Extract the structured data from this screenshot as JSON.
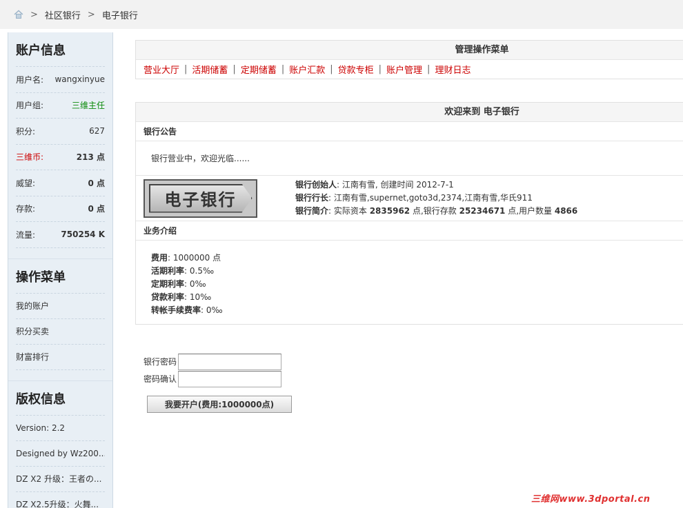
{
  "breadcrumb": {
    "sep": ">",
    "items": [
      "社区银行",
      "电子银行"
    ]
  },
  "sidebar": {
    "account_title": "账户信息",
    "account_rows": [
      {
        "k": "用户名:",
        "v": "wangxinyue"
      },
      {
        "k": "用户组:",
        "v": "三维主任"
      },
      {
        "k": "积分:",
        "v": "627"
      },
      {
        "k": "三维币:",
        "v": "213 点"
      },
      {
        "k": "威望:",
        "v": "0 点"
      },
      {
        "k": "存款:",
        "v": "0 点"
      },
      {
        "k": "流量:",
        "v": "750254 K"
      }
    ],
    "menu_title": "操作菜单",
    "menu_items": [
      "我的账户",
      "积分买卖",
      "财富排行"
    ],
    "copy_title": "版权信息",
    "copy_items": [
      "Version: 2.2",
      "Designed by Wz200...",
      "DZ X2 升级：王者の...",
      "DZ X2.5升级：火舞..."
    ]
  },
  "manage": {
    "title": "管理操作菜单",
    "bar": "|",
    "links": [
      "营业大厅",
      "活期储蓄",
      "定期储蓄",
      "账户汇款",
      "贷款专柜",
      "账户管理",
      "理财日志"
    ]
  },
  "welcome": {
    "title": "欢迎来到 电子银行",
    "notice_label": "银行公告",
    "notice_text": "银行营业中，欢迎光临......",
    "logo_text": "电子银行",
    "founder_label": "银行创始人",
    "founder_text": ": 江南有雪, 创建时间 2012-7-1",
    "heads_label": "银行行长",
    "heads_text": ": 江南有雪,supernet,goto3d,2374,江南有雪,华氏911",
    "intro_label": "银行简介",
    "intro_p1": ": 实际资本 ",
    "capital": "2835962",
    "intro_p2": " 点,银行存款 ",
    "deposits": "25234671",
    "intro_p3": " 点,用户数量 ",
    "users": "4866",
    "biz_label": "业务介绍",
    "biz_rows": [
      {
        "k": "费用",
        "v": ": 1000000 点"
      },
      {
        "k": "活期利率",
        "v": ": 0.5‰"
      },
      {
        "k": "定期利率",
        "v": ": 0‰"
      },
      {
        "k": "贷款利率",
        "v": ": 10‰"
      },
      {
        "k": "转帐手续费率",
        "v": ": 0‰"
      }
    ]
  },
  "form": {
    "password_label": "银行密码",
    "confirm_label": "密码确认",
    "submit_label": "我要开户(费用:1000000点)"
  },
  "watermark": "三维网www.3dportal.cn"
}
